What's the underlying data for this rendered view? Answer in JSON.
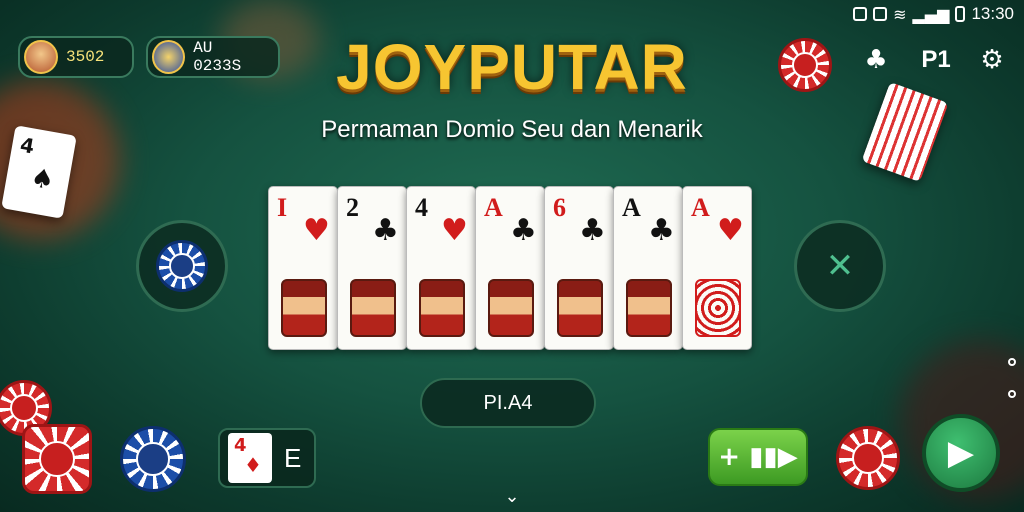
{
  "status_bar": {
    "time": "13:30"
  },
  "players": [
    {
      "name": "3502"
    },
    {
      "name": "AU 0233S"
    }
  ],
  "title": "JOYPUTAR",
  "subtitle": "Permaman Domio Seu dan Menarik",
  "top_controls": {
    "profile_label": "P1"
  },
  "hand": [
    {
      "rank": "I",
      "suit": "♥",
      "color": "red"
    },
    {
      "rank": "2",
      "suit": "♣",
      "color": "black"
    },
    {
      "rank": "4",
      "suit": "♥",
      "color": "black"
    },
    {
      "rank": "A",
      "suit": "♣",
      "color": "red"
    },
    {
      "rank": "6",
      "suit": "♣",
      "color": "red"
    },
    {
      "rank": "A",
      "suit": "♣",
      "color": "black"
    },
    {
      "rank": "A",
      "suit": "♥",
      "color": "red"
    }
  ],
  "score": {
    "label": "PI.A4"
  },
  "bottom": {
    "mini_card_rank": "4",
    "mini_label": "E",
    "speed_label": "+ ▮▮▶"
  },
  "icons": {
    "chip_left": "chip-icon",
    "clover": "clover-icon",
    "settings": "gear-icon",
    "cancel": "close-icon",
    "play": "play-icon",
    "chevron": "chevron-down-icon"
  }
}
